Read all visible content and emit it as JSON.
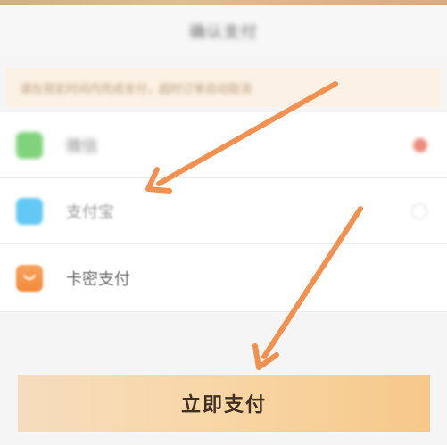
{
  "header": {
    "title": "确认支付"
  },
  "notice": {
    "text": "请在规定时间内完成支付，超时订单自动取消"
  },
  "payment_methods": [
    {
      "label": "微信",
      "icon": "wechat-icon",
      "selected": true
    },
    {
      "label": "支付宝",
      "icon": "alipay-icon",
      "selected": false
    },
    {
      "label": "卡密支付",
      "icon": "card-icon",
      "selected": false
    }
  ],
  "pay_button": {
    "label": "立即支付"
  },
  "colors": {
    "accent": "#f2914f",
    "selected_radio": "#ec8b7c",
    "button_gradient_start": "#f6dcbe",
    "button_gradient_end": "#f6c88a"
  }
}
